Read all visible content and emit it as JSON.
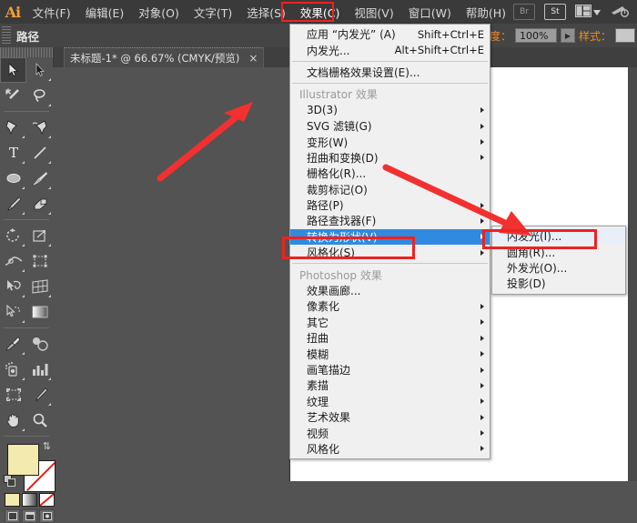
{
  "app": {
    "name": "Ai",
    "logo_text": "Ai"
  },
  "menubar": {
    "items": [
      {
        "label": "文件(F)",
        "name": "menu-file"
      },
      {
        "label": "编辑(E)",
        "name": "menu-edit"
      },
      {
        "label": "对象(O)",
        "name": "menu-object"
      },
      {
        "label": "文字(T)",
        "name": "menu-type"
      },
      {
        "label": "选择(S)",
        "name": "menu-select"
      },
      {
        "label": "效果(C)",
        "name": "menu-effect"
      },
      {
        "label": "视图(V)",
        "name": "menu-view"
      },
      {
        "label": "窗口(W)",
        "name": "menu-window"
      },
      {
        "label": "帮助(H)",
        "name": "menu-help"
      }
    ],
    "right_buttons": [
      {
        "label": "Br",
        "name": "bridge-button"
      },
      {
        "label": "St",
        "name": "stock-button"
      }
    ]
  },
  "controlbar": {
    "label": "路径",
    "opacity_label": "透明度：",
    "opacity_value": "100%",
    "style_label": "样式："
  },
  "tab": {
    "title": "未标题-1* @ 66.67% (CMYK/预览)",
    "close": "×"
  },
  "effect_menu": {
    "groups": [
      {
        "rows": [
          {
            "label": "应用 “内发光” (A)",
            "shortcut": "Shift+Ctrl+E",
            "submenu": false
          },
          {
            "label": "内发光...",
            "shortcut": "Alt+Shift+Ctrl+E",
            "submenu": false
          }
        ]
      },
      {
        "rows": [
          {
            "label": "文档栅格效果设置(E)...",
            "shortcut": "",
            "submenu": false
          }
        ]
      },
      {
        "header": "Illustrator 效果",
        "rows": [
          {
            "label": "3D(3)",
            "shortcut": "",
            "submenu": true
          },
          {
            "label": "SVG 滤镜(G)",
            "shortcut": "",
            "submenu": true
          },
          {
            "label": "变形(W)",
            "shortcut": "",
            "submenu": true
          },
          {
            "label": "扭曲和变换(D)",
            "shortcut": "",
            "submenu": true
          },
          {
            "label": "栅格化(R)...",
            "shortcut": "",
            "submenu": false
          },
          {
            "label": "裁剪标记(O)",
            "shortcut": "",
            "submenu": false
          },
          {
            "label": "路径(P)",
            "shortcut": "",
            "submenu": true
          },
          {
            "label": "路径查找器(F)",
            "shortcut": "",
            "submenu": true
          },
          {
            "label": "转换为形状(V)",
            "shortcut": "",
            "submenu": true,
            "selected": true
          },
          {
            "label": "风格化(S)",
            "shortcut": "",
            "submenu": true,
            "boxed": true
          }
        ]
      },
      {
        "header": "Photoshop 效果",
        "rows": [
          {
            "label": "效果画廊...",
            "shortcut": "",
            "submenu": false
          },
          {
            "label": "像素化",
            "shortcut": "",
            "submenu": true
          },
          {
            "label": "其它",
            "shortcut": "",
            "submenu": true
          },
          {
            "label": "扭曲",
            "shortcut": "",
            "submenu": true
          },
          {
            "label": "模糊",
            "shortcut": "",
            "submenu": true
          },
          {
            "label": "画笔描边",
            "shortcut": "",
            "submenu": true
          },
          {
            "label": "素描",
            "shortcut": "",
            "submenu": true
          },
          {
            "label": "纹理",
            "shortcut": "",
            "submenu": true
          },
          {
            "label": "艺术效果",
            "shortcut": "",
            "submenu": true
          },
          {
            "label": "视频",
            "shortcut": "",
            "submenu": true
          },
          {
            "label": "风格化",
            "shortcut": "",
            "submenu": true
          }
        ]
      }
    ]
  },
  "style_submenu": {
    "items": [
      {
        "label": "内发光(I)...",
        "highlighted": true
      },
      {
        "label": "圆角(R)...",
        "highlighted": false
      },
      {
        "label": "外发光(O)...",
        "highlighted": false
      },
      {
        "label": "投影(D)",
        "highlighted": false
      }
    ]
  },
  "toolbar": {
    "tools": [
      {
        "name": "selection-tool",
        "selected": true
      },
      {
        "name": "direct-selection-tool",
        "selected": false
      },
      {
        "name": "magic-wand-tool",
        "selected": false
      },
      {
        "name": "lasso-tool",
        "selected": false
      },
      {
        "name": "pen-tool",
        "selected": false
      },
      {
        "name": "add-anchor-point-tool",
        "selected": false
      },
      {
        "name": "type-tool",
        "selected": false
      },
      {
        "name": "line-segment-tool",
        "selected": false
      },
      {
        "name": "ellipse-tool",
        "selected": false
      },
      {
        "name": "paintbrush-tool",
        "selected": false
      },
      {
        "name": "pencil-tool",
        "selected": false
      },
      {
        "name": "eraser-tool",
        "selected": false
      },
      {
        "name": "rotate-tool",
        "selected": false
      },
      {
        "name": "scale-tool",
        "selected": false
      },
      {
        "name": "width-tool",
        "selected": false
      },
      {
        "name": "free-transform-tool",
        "selected": false
      },
      {
        "name": "shape-builder-tool",
        "selected": false
      },
      {
        "name": "perspective-grid-tool",
        "selected": false
      },
      {
        "name": "mesh-tool",
        "selected": false
      },
      {
        "name": "gradient-tool",
        "selected": false
      },
      {
        "name": "eyedropper-tool",
        "selected": false
      },
      {
        "name": "blend-tool",
        "selected": false
      },
      {
        "name": "symbol-sprayer-tool",
        "selected": false
      },
      {
        "name": "column-graph-tool",
        "selected": false
      },
      {
        "name": "artboard-tool",
        "selected": false
      },
      {
        "name": "slice-tool",
        "selected": false
      },
      {
        "name": "hand-tool",
        "selected": false
      },
      {
        "name": "zoom-tool",
        "selected": false
      }
    ],
    "fill_color": "#f2eaae",
    "stroke_color": "#ffffff",
    "stroke_none": true
  },
  "canvas": {
    "shape_fill": "#f2eaae",
    "selection_color": "#2d6fd1"
  },
  "annotations": {
    "accent_color": "#ee2222",
    "boxes": [
      {
        "name": "effect-menu-highlight"
      },
      {
        "name": "stylize-item-highlight"
      },
      {
        "name": "inner-glow-item-highlight"
      }
    ],
    "arrows": [
      {
        "name": "canvas-pointer-arrow"
      },
      {
        "name": "menu-pointer-arrow"
      }
    ]
  }
}
